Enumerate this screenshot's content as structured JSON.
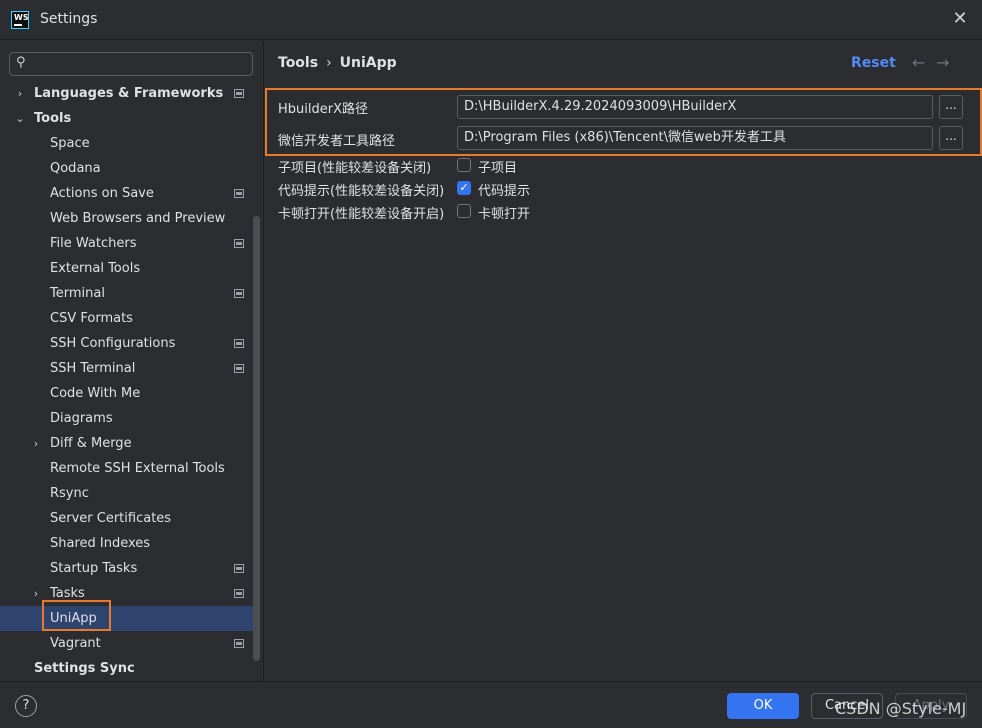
{
  "window": {
    "logo_text": "WS",
    "title": "Settings",
    "close_glyph": "✕"
  },
  "sidebar": {
    "search": {
      "value": "",
      "placeholder": "",
      "icon": "search-icon"
    },
    "items": [
      {
        "label": "Languages & Frameworks",
        "expandable": true,
        "expanded": false,
        "bold": true,
        "project_icon": true
      },
      {
        "label": "Tools",
        "expandable": true,
        "expanded": true,
        "bold": true,
        "project_icon": false
      },
      {
        "label": "Space",
        "project_icon": false
      },
      {
        "label": "Qodana",
        "project_icon": false
      },
      {
        "label": "Actions on Save",
        "project_icon": true
      },
      {
        "label": "Web Browsers and Preview",
        "project_icon": false
      },
      {
        "label": "File Watchers",
        "project_icon": true
      },
      {
        "label": "External Tools",
        "project_icon": false
      },
      {
        "label": "Terminal",
        "project_icon": true
      },
      {
        "label": "CSV Formats",
        "project_icon": false
      },
      {
        "label": "SSH Configurations",
        "project_icon": true
      },
      {
        "label": "SSH Terminal",
        "project_icon": true
      },
      {
        "label": "Code With Me",
        "project_icon": false
      },
      {
        "label": "Diagrams",
        "project_icon": false
      },
      {
        "label": "Diff & Merge",
        "expandable": true,
        "expanded": false,
        "project_icon": false
      },
      {
        "label": "Remote SSH External Tools",
        "project_icon": false
      },
      {
        "label": "Rsync",
        "project_icon": false
      },
      {
        "label": "Server Certificates",
        "project_icon": false
      },
      {
        "label": "Shared Indexes",
        "project_icon": false
      },
      {
        "label": "Startup Tasks",
        "project_icon": true
      },
      {
        "label": "Tasks",
        "expandable": true,
        "expanded": false,
        "project_icon": true
      },
      {
        "label": "UniApp",
        "selected": true,
        "project_icon": false
      },
      {
        "label": "Vagrant",
        "project_icon": true
      },
      {
        "label": "Settings Sync",
        "bold": true,
        "project_icon": false
      }
    ]
  },
  "main": {
    "breadcrumb": {
      "parent": "Tools",
      "separator": "›",
      "current": "UniApp"
    },
    "reset_label": "Reset",
    "back_glyph": "←",
    "forward_glyph": "→",
    "paths": [
      {
        "label": "HbuilderX路径",
        "value": "D:\\HBuilderX.4.29.2024093009\\HBuilderX",
        "browse": "..."
      },
      {
        "label": "微信开发者工具路径",
        "value": "D:\\Program Files (x86)\\Tencent\\微信web开发者工具",
        "browse": "..."
      }
    ],
    "options": [
      {
        "label": "子项目(性能较差设备关闭)",
        "checkbox_label": "子项目",
        "checked": false
      },
      {
        "label": "代码提示(性能较差设备关闭)",
        "checkbox_label": "代码提示",
        "checked": true
      },
      {
        "label": "卡顿打开(性能较差设备开启)",
        "checkbox_label": "卡顿打开",
        "checked": false
      }
    ],
    "check_glyph": "✓"
  },
  "footer": {
    "help_glyph": "?",
    "ok_label": "OK",
    "cancel_label": "Cancel",
    "apply_label": "Apply",
    "watermark": "CSDN @Style-MJ"
  },
  "colors": {
    "background": "#2b2d30",
    "accent": "#3574f0",
    "link": "#548af7",
    "selection": "#2e436e",
    "annotation": "#e87a2f"
  }
}
